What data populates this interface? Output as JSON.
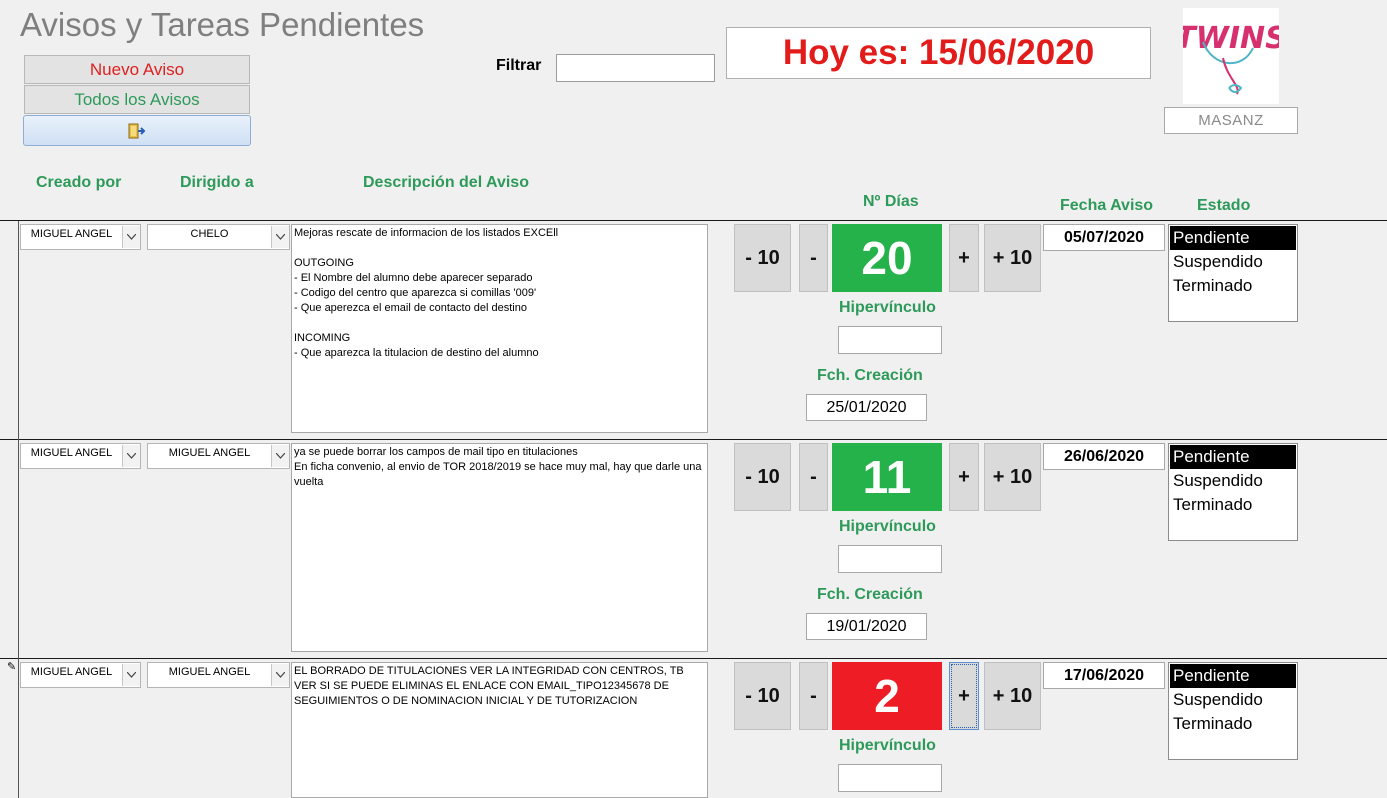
{
  "header": {
    "title": "Avisos y Tareas Pendientes",
    "new_notice_label": "Nuevo Aviso",
    "all_notices_label": "Todos los Avisos",
    "filter_label": "Filtrar",
    "filter_value": "",
    "today_text": "Hoy es: 15/06/2020",
    "user": "MASANZ",
    "logo_text": "TWINS"
  },
  "columns": {
    "creado_por": "Creado por",
    "dirigido_a": "Dirigido a",
    "descripcion": "Descripción del Aviso",
    "num_dias": "Nº Días",
    "fecha_aviso": "Fecha Aviso",
    "estado": "Estado"
  },
  "labels": {
    "minus10": "- 10",
    "minus": "-",
    "plus": "+",
    "plus10": "+ 10",
    "hipervinculo": "Hipervínculo",
    "fch_creacion": "Fch. Creación"
  },
  "status_options": [
    "Pendiente",
    "Suspendido",
    "Terminado"
  ],
  "colors": {
    "days_green": "#25b24a",
    "days_red": "#ee1c24",
    "today_red": "#e21b1b",
    "header_green": "#2e9a5a"
  },
  "records": [
    {
      "creado_por": "MIGUEL ANGEL",
      "dirigido_a": "CHELO",
      "descripcion": "Mejoras rescate de informacion de los listados EXCEll\n\nOUTGOING\n- El Nombre del alumno debe aparecer separado\n- Codigo del centro que aparezca si comillas '009'\n- Que aperezca el email de contacto del destino\n\nINCOMING\n- Que aparezca la titulacion de destino del alumno",
      "dias": "20",
      "dias_color": "green",
      "hipervinculo": "",
      "fecha_creacion": "25/01/2020",
      "fecha_aviso": "05/07/2020",
      "estado": "Pendiente"
    },
    {
      "creado_por": "MIGUEL ANGEL",
      "dirigido_a": "MIGUEL ANGEL",
      "descripcion": "ya se puede borrar los campos de mail tipo en titulaciones\nEn ficha convenio, al envio de TOR 2018/2019 se hace muy mal, hay que darle una vuelta",
      "dias": "11",
      "dias_color": "green",
      "hipervinculo": "",
      "fecha_creacion": "19/01/2020",
      "fecha_aviso": "26/06/2020",
      "estado": "Pendiente"
    },
    {
      "creado_por": "MIGUEL ANGEL",
      "dirigido_a": "MIGUEL ANGEL",
      "descripcion": "EL BORRADO DE TITULACIONES VER LA INTEGRIDAD CON CENTROS, TB VER SI SE PUEDE ELIMINAS EL ENLACE CON EMAIL_TIPO12345678 DE SEGUIMIENTOS O DE NOMINACION INICIAL Y DE TUTORIZACION",
      "dias": "2",
      "dias_color": "red",
      "hipervinculo": "",
      "fecha_creacion": "",
      "fecha_aviso": "17/06/2020",
      "estado": "Pendiente"
    }
  ]
}
